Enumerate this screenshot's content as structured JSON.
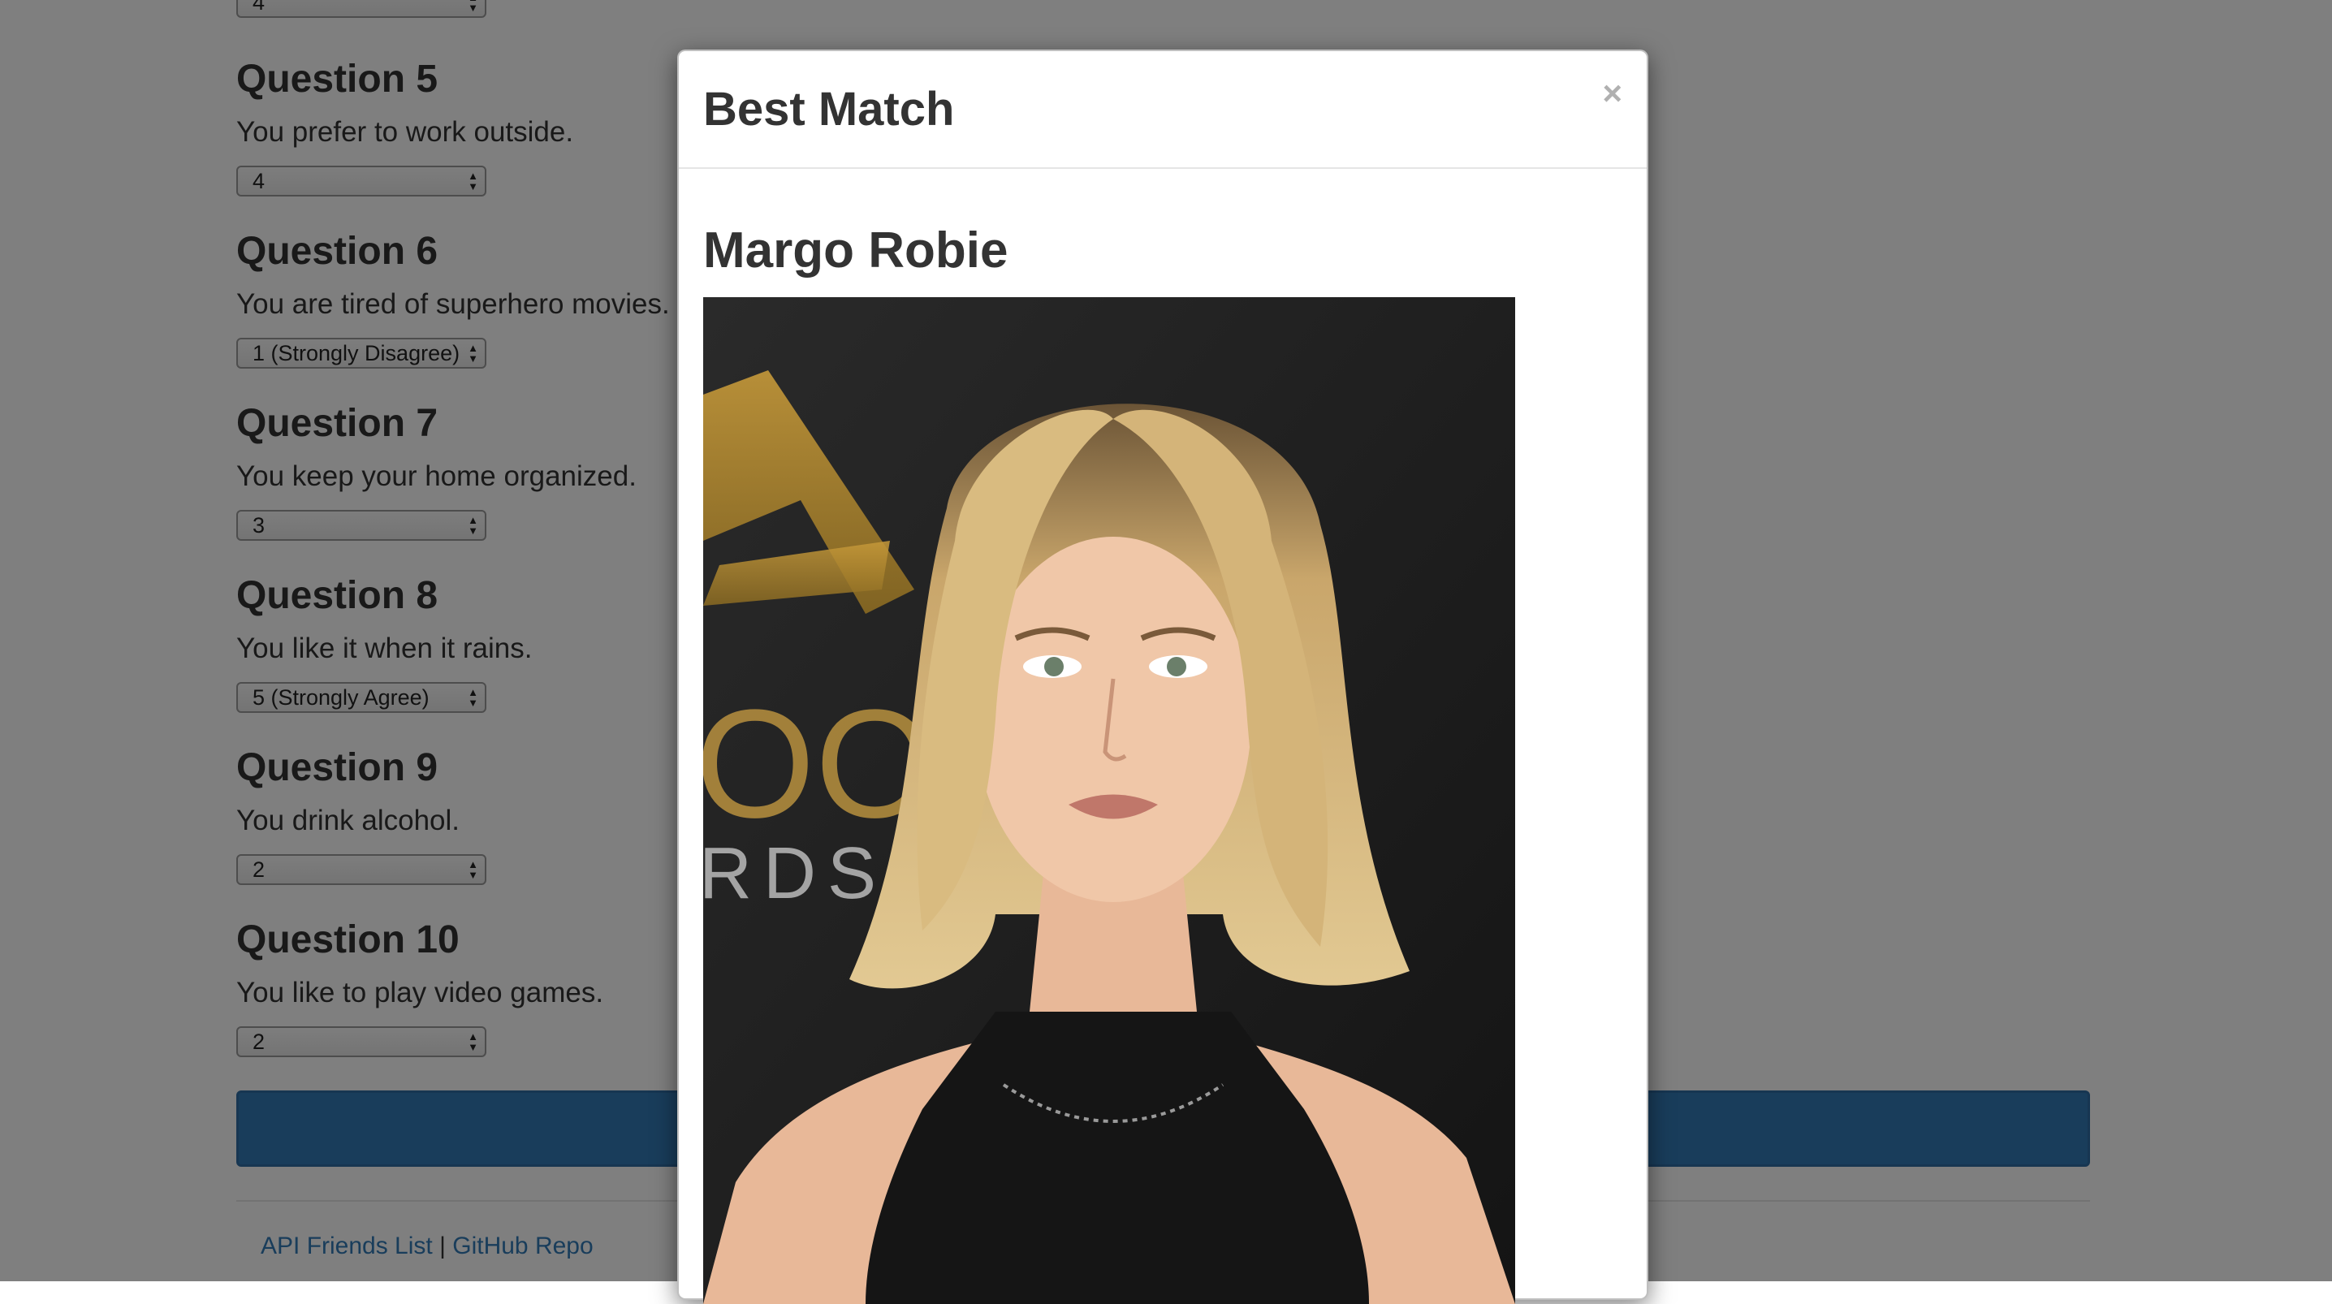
{
  "form": {
    "top_select_value": "4",
    "questions": [
      {
        "heading": "Question 5",
        "text": "You prefer to work outside.",
        "value": "4"
      },
      {
        "heading": "Question 6",
        "text": "You are tired of superhero movies.",
        "value": "1 (Strongly Disagree)"
      },
      {
        "heading": "Question 7",
        "text": "You keep your home organized.",
        "value": "3"
      },
      {
        "heading": "Question 8",
        "text": "You like it when it rains.",
        "value": "5 (Strongly Agree)"
      },
      {
        "heading": "Question 9",
        "text": "You drink alcohol.",
        "value": "2"
      },
      {
        "heading": "Question 10",
        "text": "You like to play video games.",
        "value": "2"
      }
    ]
  },
  "footer": {
    "link1": "API Friends List",
    "separator": "|",
    "link2": "GitHub Repo"
  },
  "modal": {
    "title": "Best Match",
    "close": "×",
    "name": "Margo Robie"
  },
  "colors": {
    "primary": "#337ab7",
    "link": "#337ab7",
    "backdrop": "rgba(0,0,0,0.5)"
  }
}
